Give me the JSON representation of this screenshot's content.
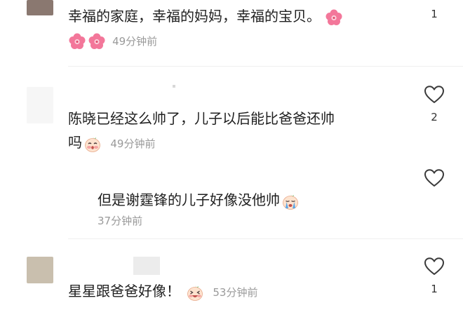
{
  "comments": [
    {
      "text": "幸福的家庭，幸福的妈妈，幸福的宝贝。",
      "time": "49分钟前",
      "likes": "1"
    },
    {
      "text_line1": "陈晓已经这么帅了，儿子以后能比爸爸还帅",
      "text_line2": "吗",
      "time": "49分钟前",
      "likes": "2"
    },
    {
      "text": "但是谢霆锋的儿子好像没他帅",
      "time": "37分钟前",
      "likes": ""
    },
    {
      "text": "星星跟爸爸好像！",
      "time": "53分钟前",
      "likes": "1"
    }
  ],
  "icons": {
    "like": "heart-outline-icon",
    "flower": "pink-flower-emoji",
    "blush": "blushing-face-emoji",
    "cry": "crying-face-emoji",
    "laugh": "laughing-face-emoji"
  },
  "colors": {
    "text": "#1f1f1f",
    "meta": "#9a9a9a",
    "flower": "#f06a8a",
    "divider": "#efefef"
  }
}
